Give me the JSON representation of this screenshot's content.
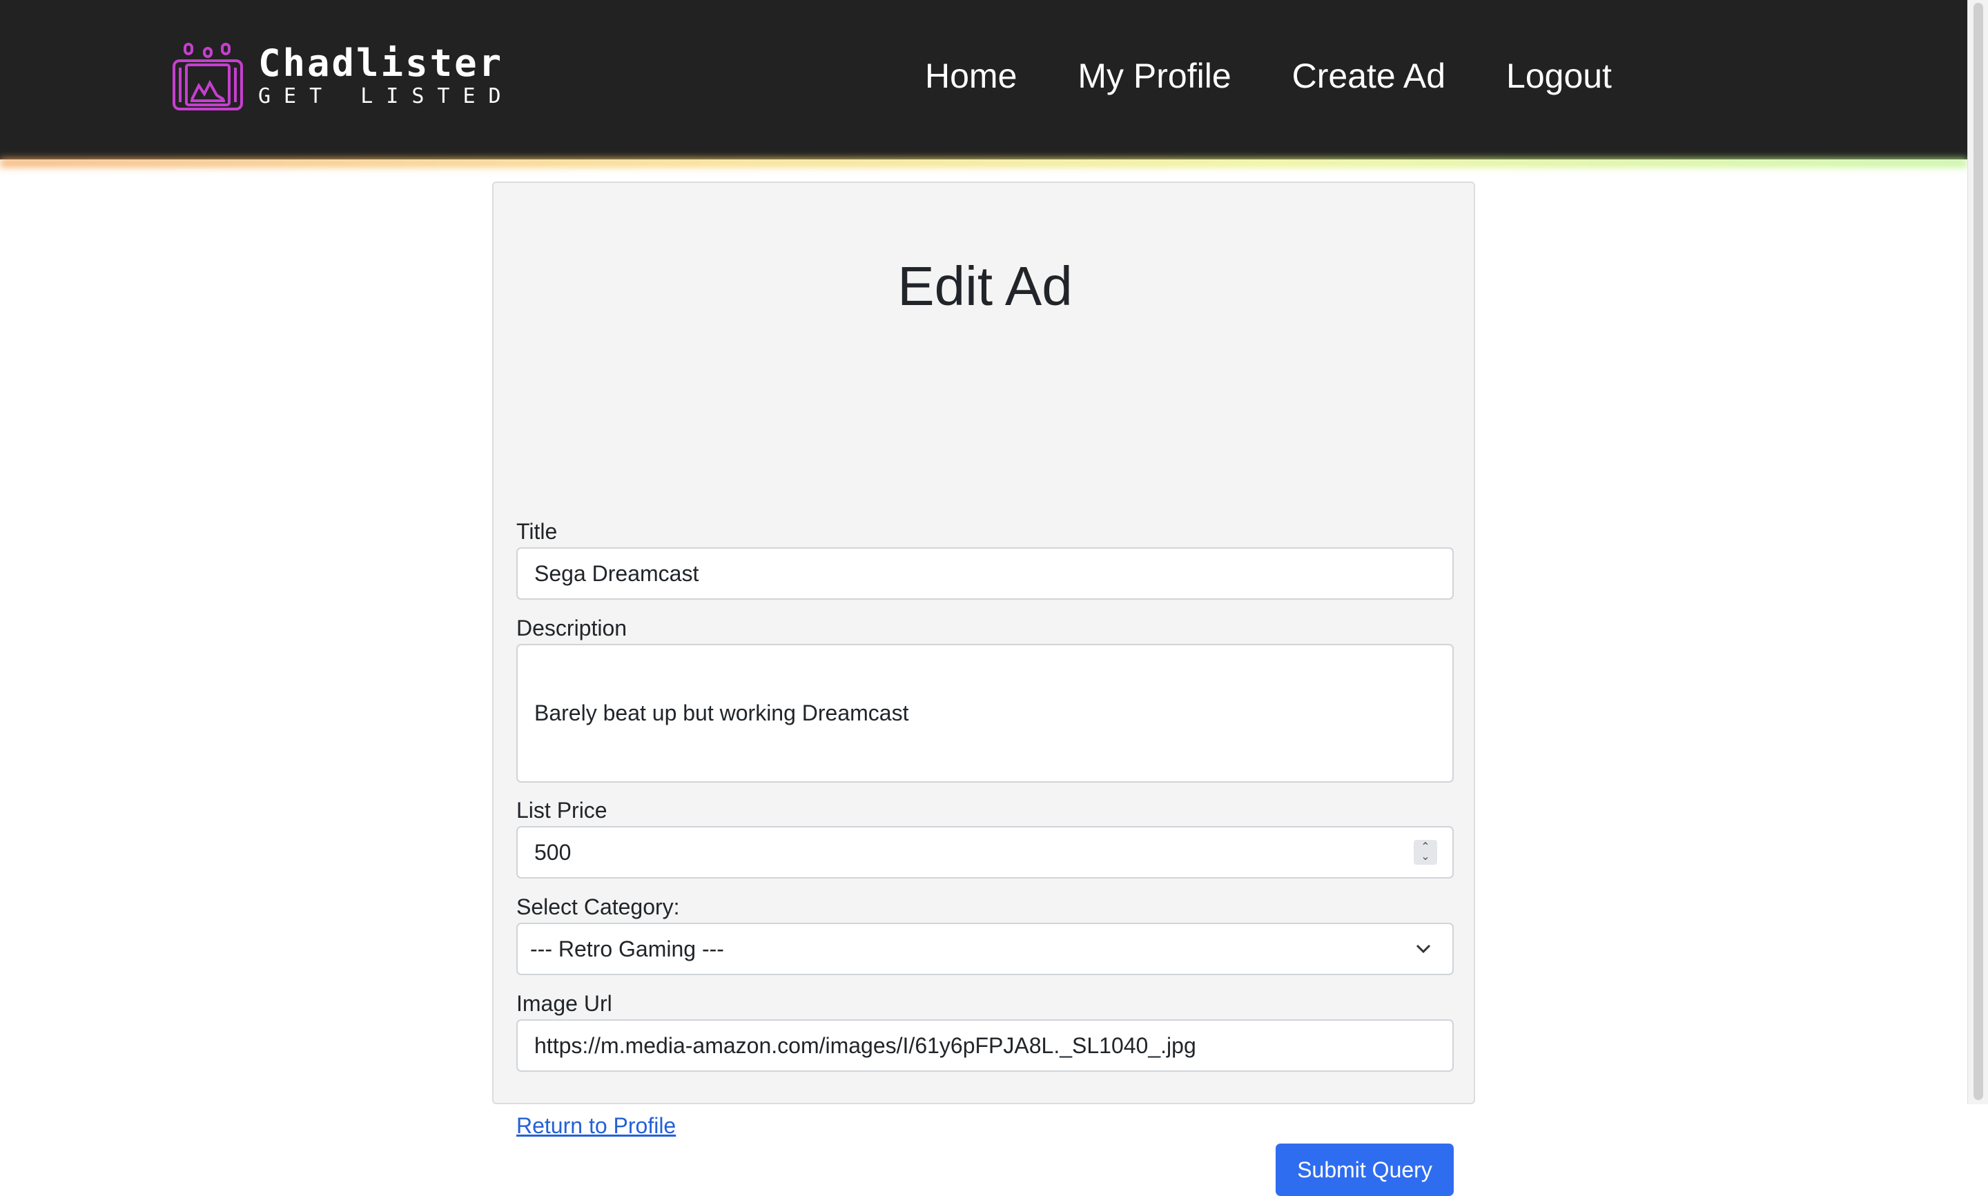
{
  "brand": {
    "name": "Chadlister",
    "tagline": "GET LISTED",
    "accent_color": "#c63fd0"
  },
  "nav": {
    "items": [
      {
        "label": "Home"
      },
      {
        "label": "My Profile"
      },
      {
        "label": "Create Ad"
      },
      {
        "label": "Logout"
      }
    ]
  },
  "form": {
    "heading": "Edit Ad",
    "title_label": "Title",
    "title_value": "Sega Dreamcast",
    "description_label": "Description",
    "description_value": "Barely beat up but working Dreamcast",
    "price_label": "List Price",
    "price_value": "500",
    "category_label": "Select Category:",
    "category_value": "--- Retro Gaming ---",
    "image_label": "Image Url",
    "image_value": "https://m.media-amazon.com/images/I/61y6pFPJA8L._SL1040_.jpg",
    "return_link": "Return to Profile",
    "submit_label": "Submit Query"
  },
  "colors": {
    "header_bg": "#222222",
    "submit_bg": "#2f6df0",
    "link": "#2460d9"
  }
}
